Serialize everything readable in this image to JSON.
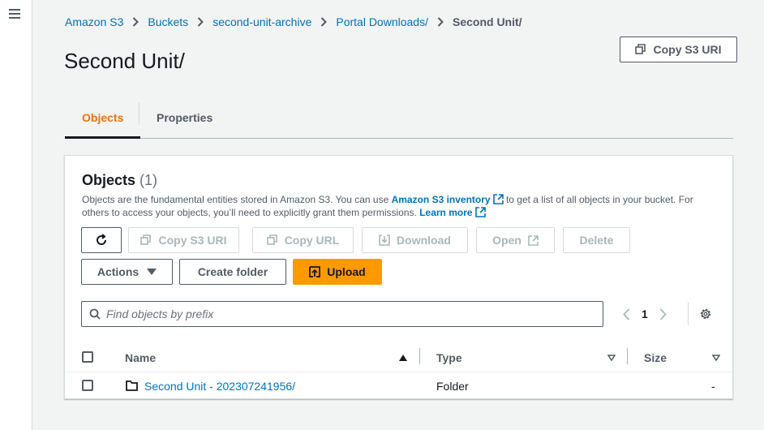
{
  "nav": {
    "menu_icon": "hamburger-menu-icon"
  },
  "breadcrumbs": [
    "Amazon S3",
    "Buckets",
    "second-unit-archive",
    "Portal Downloads/",
    "Second Unit/"
  ],
  "page": {
    "title": "Second Unit/",
    "copy_uri_label": "Copy S3 URI"
  },
  "tabs": [
    {
      "label": "Objects",
      "active": true
    },
    {
      "label": "Properties",
      "active": false
    }
  ],
  "objects_panel": {
    "title": "Objects",
    "count": "(1)",
    "desc_1": "Objects are the fundamental entities stored in Amazon S3. You can use ",
    "desc_link_1": "Amazon S3 inventory",
    "desc_2": " to get a list of all objects in your bucket. For others to access your objects, you’ll need to explicitly grant them permissions. ",
    "desc_link_2": "Learn more",
    "buttons": {
      "copy_uri": "Copy S3 URI",
      "copy_url": "Copy URL",
      "download": "Download",
      "open": "Open",
      "delete": "Delete",
      "actions": "Actions",
      "create_folder": "Create folder",
      "upload": "Upload"
    },
    "search_placeholder": "Find objects by prefix",
    "page_number": "1",
    "columns": {
      "name": "Name",
      "type": "Type",
      "size": "Size"
    },
    "rows": [
      {
        "name": "Second Unit - 202307241956/",
        "type": "Folder",
        "size": "-"
      }
    ]
  },
  "colors": {
    "accent": "#ec7211",
    "link": "#0073bb",
    "primary": "#ff9900"
  }
}
